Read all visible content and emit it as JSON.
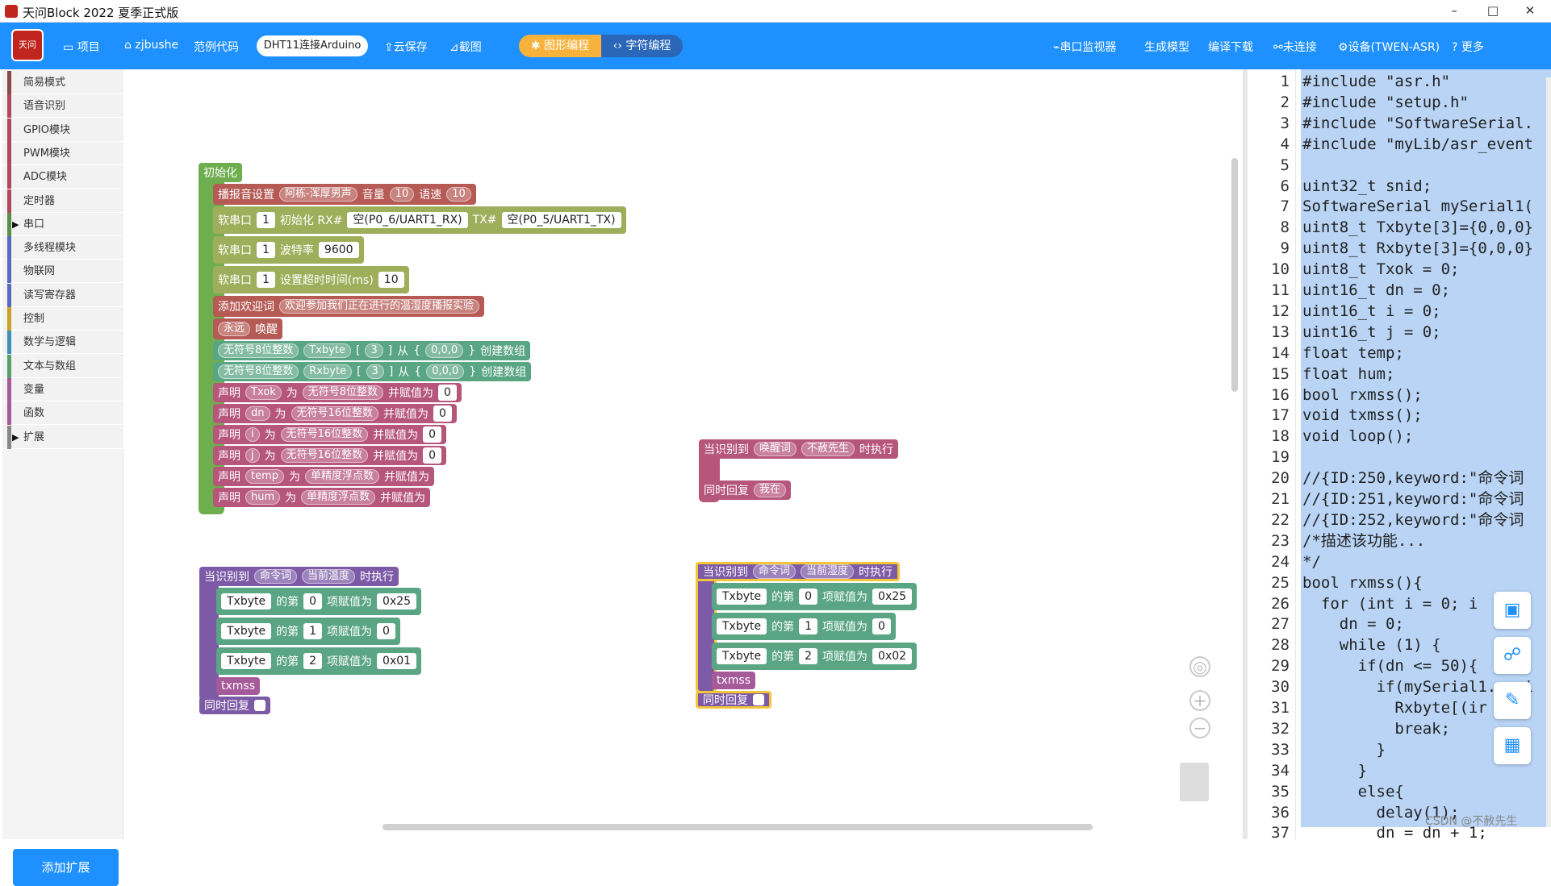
{
  "window": {
    "title": "天问Block 2022 夏季正式版",
    "min": "–",
    "max": "□",
    "close": "✕"
  },
  "toolbar": {
    "logo_text": "天问",
    "project": "项目",
    "user": "zjbushe",
    "examples": "范例代码",
    "project_name": "DHT11连接Arduino",
    "cloud_save": "云保存",
    "screenshot": "截图",
    "block_mode": "图形编程",
    "text_mode": "字符编程",
    "serial_monitor": "串口监视器",
    "gen_model": "生成模型",
    "compile": "编译下载",
    "connect": "未连接",
    "device": "设备(TWEN-ASR)",
    "more": "更多"
  },
  "sidebar": {
    "items": [
      {
        "label": "简易模式",
        "color": "#8b4a4a"
      },
      {
        "label": "语音识别",
        "color": "#b2495a"
      },
      {
        "label": "GPIO模块",
        "color": "#b2495a"
      },
      {
        "label": "PWM模块",
        "color": "#b2495a"
      },
      {
        "label": "ADC模块",
        "color": "#b2495a"
      },
      {
        "label": "定时器",
        "color": "#b2495a"
      },
      {
        "label": "串口",
        "color": "#5a8f4a",
        "arrow": "▶"
      },
      {
        "label": "多线程模块",
        "color": "#5a6abf"
      },
      {
        "label": "物联网",
        "color": "#5a6abf"
      },
      {
        "label": "读写寄存器",
        "color": "#5a6abf"
      },
      {
        "label": "控制",
        "color": "#c9a227"
      },
      {
        "label": "数学与逻辑",
        "color": "#3f8fb8"
      },
      {
        "label": "文本与数组",
        "color": "#5aa06a"
      },
      {
        "label": "变量",
        "color": "#a55a9a"
      },
      {
        "label": "函数",
        "color": "#a55a9a"
      },
      {
        "label": "扩展",
        "color": "#888888",
        "arrow": "▶"
      }
    ],
    "add_ext": "添加扩展"
  },
  "blocks": {
    "init": {
      "hat": "初始化",
      "r1": {
        "a": "播报音设置",
        "voice": "阿栋-浑厚男声",
        "b": "音量",
        "vol": "10",
        "c": "语速",
        "speed": "10"
      },
      "r2": {
        "a": "软串口",
        "port": "1",
        "b": "初始化 RX#",
        "rx": "空(P0_6/UART1_RX)",
        "c": "TX#",
        "tx": "空(P0_5/UART1_TX)"
      },
      "r3": {
        "a": "软串口",
        "port": "1",
        "b": "波特率",
        "baud": "9600"
      },
      "r4": {
        "a": "软串口",
        "port": "1",
        "b": "设置超时时间(ms)",
        "ms": "10"
      },
      "r5": {
        "a": "添加欢迎词",
        "text": "欢迎参加我们正在进行的温湿度播报实验"
      },
      "r6": {
        "a": "永远",
        "b": "唤醒"
      },
      "r7": {
        "type": "无符号8位整数",
        "name": "Txbyte",
        "lb": "[",
        "size": "3",
        "rb": "]",
        "from": "从",
        "ob": "{",
        "vals": "0,0,0",
        "cb": "}",
        "create": "创建数组"
      },
      "r8": {
        "type": "无符号8位整数",
        "name": "Rxbyte",
        "lb": "[",
        "size": "3",
        "rb": "]",
        "from": "从",
        "ob": "{",
        "vals": "0,0,0",
        "cb": "}",
        "create": "创建数组"
      },
      "r9": {
        "a": "声明",
        "name": "Txok",
        "as": "为",
        "type": "无符号8位整数",
        "assign": "并赋值为",
        "val": "0"
      },
      "r10": {
        "a": "声明",
        "name": "dn",
        "as": "为",
        "type": "无符号16位整数",
        "assign": "并赋值为",
        "val": "0"
      },
      "r11": {
        "a": "声明",
        "name": "i",
        "as": "为",
        "type": "无符号16位整数",
        "assign": "并赋值为",
        "val": "0"
      },
      "r12": {
        "a": "声明",
        "name": "j",
        "as": "为",
        "type": "无符号16位整数",
        "assign": "并赋值为",
        "val": "0"
      },
      "r13": {
        "a": "声明",
        "name": "temp",
        "as": "为",
        "type": "单精度浮点数",
        "assign": "并赋值为"
      },
      "r14": {
        "a": "声明",
        "name": "hum",
        "as": "为",
        "type": "单精度浮点数",
        "assign": "并赋值为"
      }
    },
    "wake": {
      "a": "当识别到",
      "kw": "唤醒词",
      "word": "不赦先生",
      "b": "时执行",
      "reply": "同时回复",
      "reply_text": "我在"
    },
    "cmd1": {
      "a": "当识别到",
      "kw": "命令词",
      "word": "当前温度",
      "b": "时执行",
      "rows": [
        {
          "arr": "Txbyte",
          "of": "的第",
          "idx": "0",
          "set": "项赋值为",
          "val": "0x25"
        },
        {
          "arr": "Txbyte",
          "of": "的第",
          "idx": "1",
          "set": "项赋值为",
          "val": "0"
        },
        {
          "arr": "Txbyte",
          "of": "的第",
          "idx": "2",
          "set": "项赋值为",
          "val": "0x01"
        }
      ],
      "call": "txmss",
      "reply": "同时回复"
    },
    "cmd2": {
      "a": "当识别到",
      "kw": "命令词",
      "word": "当前湿度",
      "b": "时执行",
      "rows": [
        {
          "arr": "Txbyte",
          "of": "的第",
          "idx": "0",
          "set": "项赋值为",
          "val": "0x25"
        },
        {
          "arr": "Txbyte",
          "of": "的第",
          "idx": "1",
          "set": "项赋值为",
          "val": "0"
        },
        {
          "arr": "Txbyte",
          "of": "的第",
          "idx": "2",
          "set": "项赋值为",
          "val": "0x02"
        }
      ],
      "call": "txmss",
      "reply": "同时回复"
    }
  },
  "controls": {
    "center": "◎",
    "zoom_in": "+",
    "zoom_out": "−"
  },
  "code": {
    "lines": [
      "#include \"asr.h\"",
      "#include \"setup.h\"",
      "#include \"SoftwareSerial.",
      "#include \"myLib/asr_event",
      "",
      "uint32_t snid;",
      "SoftwareSerial mySerial1(",
      "uint8_t Txbyte[3]={0,0,0}",
      "uint8_t Rxbyte[3]={0,0,0}",
      "uint8_t Txok = 0;",
      "uint16_t dn = 0;",
      "uint16_t i = 0;",
      "uint16_t j = 0;",
      "float temp;",
      "float hum;",
      "bool rxmss();",
      "void txmss();",
      "void loop();",
      "",
      "//{ID:250,keyword:\"命令词",
      "//{ID:251,keyword:\"命令词",
      "//{ID:252,keyword:\"命令词",
      "/*描述该功能...",
      "*/",
      "bool rxmss(){",
      "  for (int i = 0; i",
      "    dn = 0;",
      "    while (1) {",
      "      if(dn <= 50){",
      "        if(mySerial1.avai",
      "          Rxbyte[(ir",
      "          break;",
      "        }",
      "      }",
      "      else{",
      "        delay(1);",
      "        dn = dn + 1;"
    ],
    "numbers": [
      "1",
      "2",
      "3",
      "4",
      "5",
      "6",
      "7",
      "8",
      "9",
      "10",
      "11",
      "12",
      "13",
      "14",
      "15",
      "16",
      "17",
      "18",
      "19",
      "20",
      "21",
      "22",
      "23",
      "24",
      "25",
      "26",
      "27",
      "28",
      "29",
      "30",
      "31",
      "32",
      "33",
      "34",
      "35",
      "36",
      "37"
    ]
  },
  "watermark": "CSDN @不赦先生"
}
